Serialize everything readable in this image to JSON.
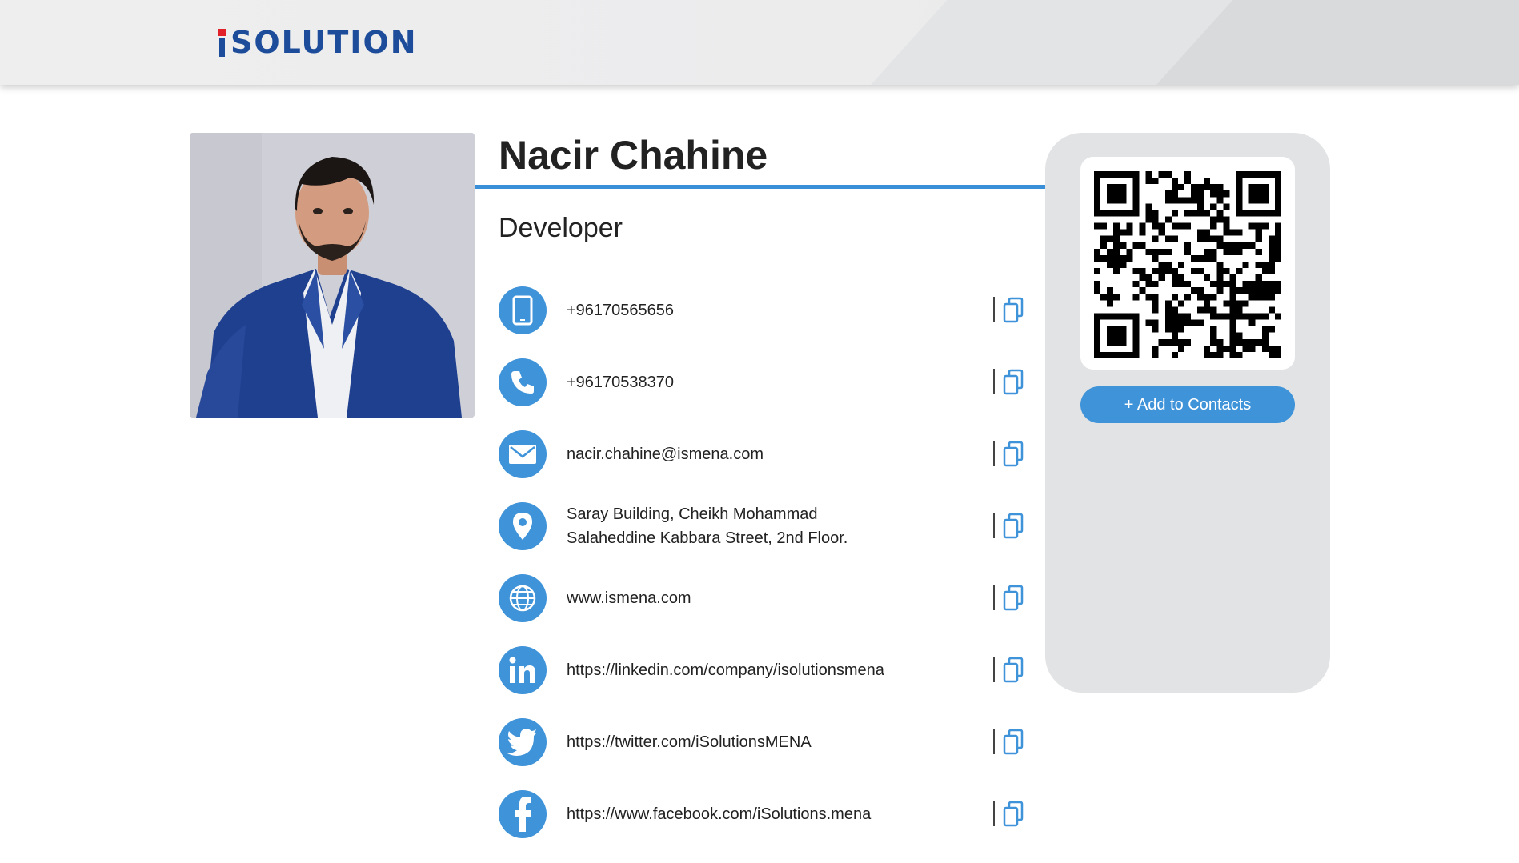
{
  "brand": {
    "logo_text": "SOLUTION"
  },
  "profile": {
    "name": "Nacir Chahine",
    "role": "Developer"
  },
  "contacts": [
    {
      "icon": "mobile-phone-icon",
      "value": "+96170565656"
    },
    {
      "icon": "phone-icon",
      "value": "+96170538370"
    },
    {
      "icon": "email-icon",
      "value": "nacir.chahine@ismena.com"
    },
    {
      "icon": "location-pin-icon",
      "line1": "Saray Building, Cheikh Mohammad",
      "line2": "Salaheddine Kabbara Street, 2nd Floor."
    },
    {
      "icon": "globe-icon",
      "value": "www.ismena.com"
    },
    {
      "icon": "linkedin-icon",
      "value": "https://linkedin.com/company/isolutionsmena"
    },
    {
      "icon": "twitter-icon",
      "value": "https://twitter.com/iSolutionsMENA"
    },
    {
      "icon": "facebook-icon",
      "value": "https://www.facebook.com/iSolutions.mena"
    }
  ],
  "card": {
    "add_button": "+ Add to Contacts"
  },
  "colors": {
    "accent": "#3f93d9",
    "logo_blue": "#1c4c9a",
    "logo_red": "#e2202a",
    "side_panel": "#e2e3e4"
  }
}
